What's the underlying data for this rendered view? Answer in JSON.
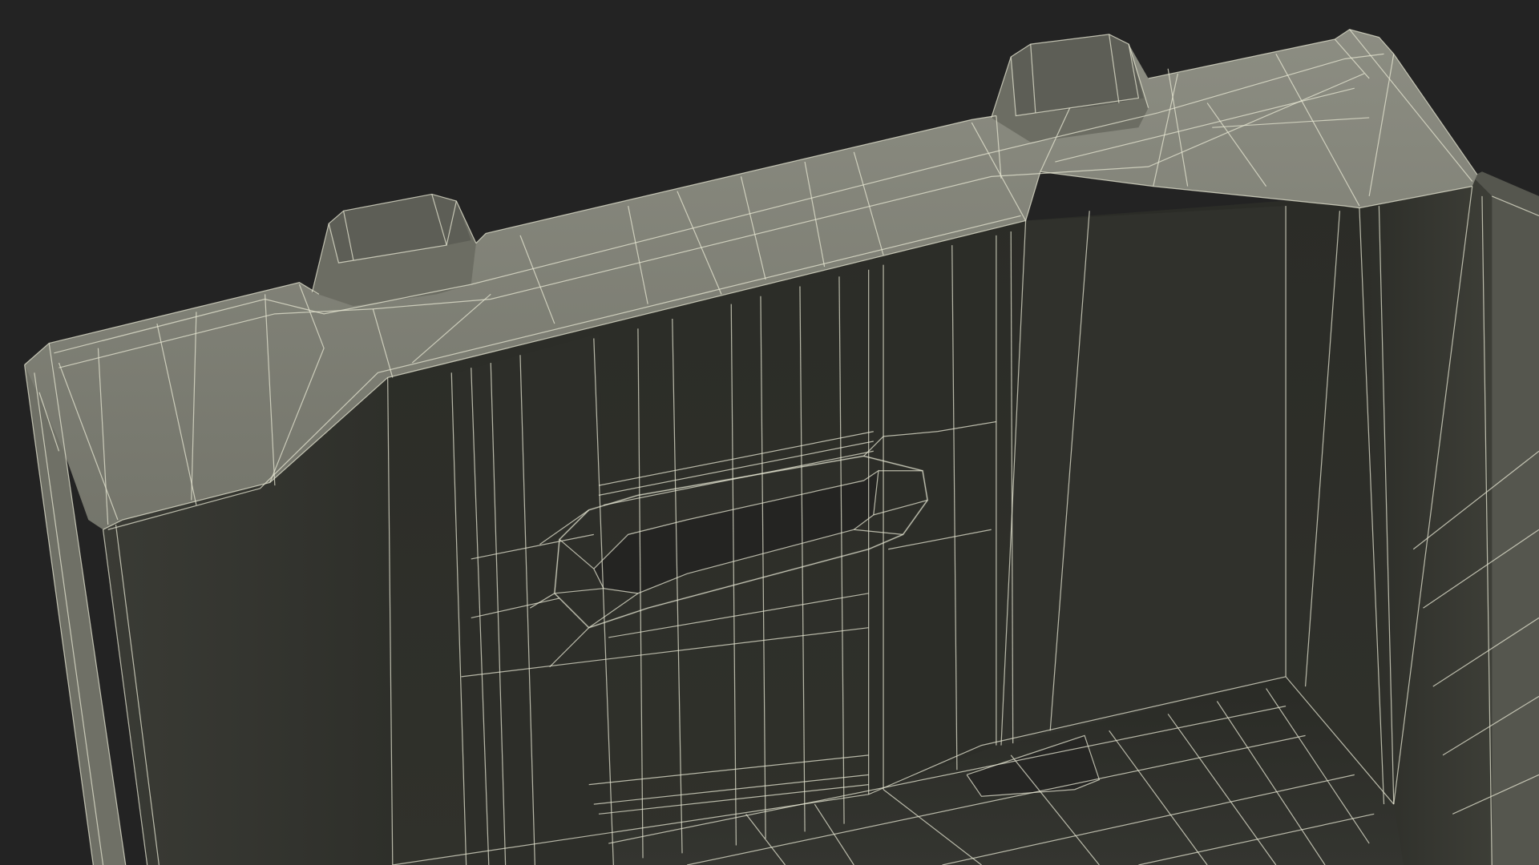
{
  "scene": {
    "subject": "crate-wireframe-render",
    "background_color": "#232323",
    "surface_color": "#7d7e73",
    "interior_color": "#2f302b",
    "wire_color": "#e6e6d2"
  }
}
